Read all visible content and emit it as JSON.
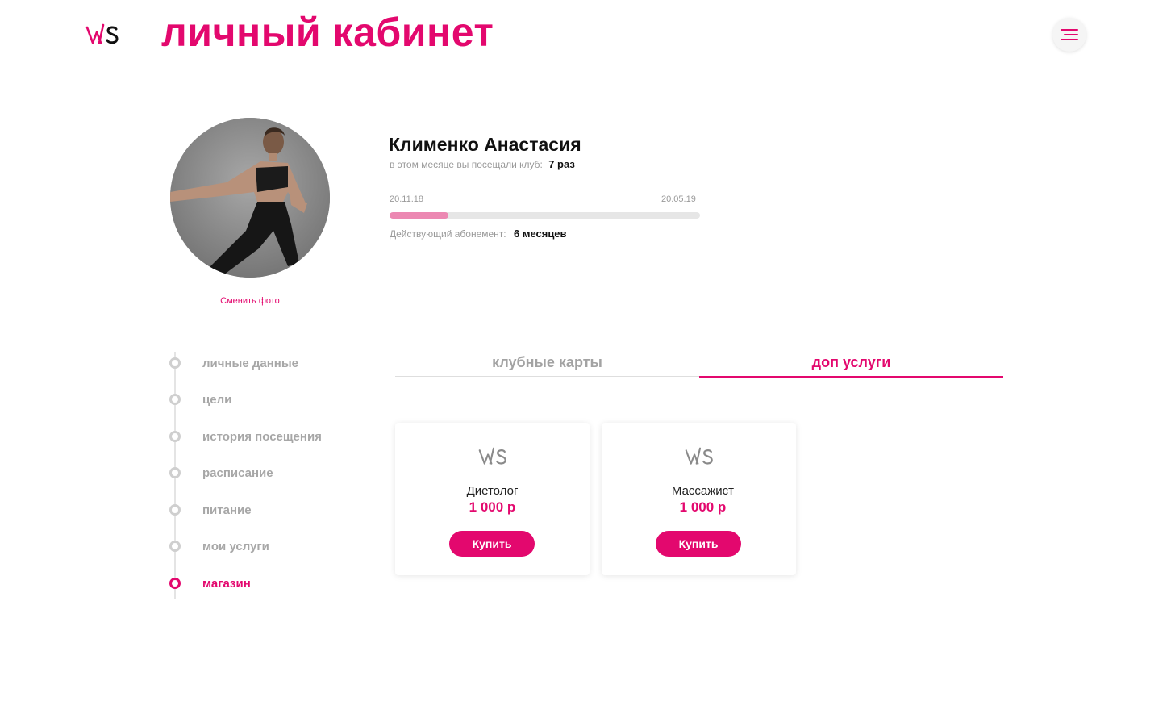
{
  "header": {
    "title": "личный кабинет",
    "logo_icon": "ws-logo-icon",
    "menu_icon": "hamburger-menu-icon"
  },
  "profile": {
    "name": "Клименко Анастасия",
    "visits_label": "в этом месяце вы посещали клуб:",
    "visits_value": "7 раз",
    "date_start": "20.11.18",
    "date_end": "20.05.19",
    "progress_fraction": 0.19,
    "subscription_label": "Действующий абонемент:",
    "subscription_value": "6 месяцев",
    "change_photo": "Сменить фото"
  },
  "sidebar": {
    "items": [
      {
        "label": "личные данные",
        "active": false
      },
      {
        "label": "цели",
        "active": false
      },
      {
        "label": "история посещения",
        "active": false
      },
      {
        "label": "расписание",
        "active": false
      },
      {
        "label": "питание",
        "active": false
      },
      {
        "label": "мои услуги",
        "active": false
      },
      {
        "label": "магазин",
        "active": true
      }
    ]
  },
  "tabs": [
    {
      "label": "клубные карты",
      "active": false
    },
    {
      "label": "доп услуги",
      "active": true
    }
  ],
  "cards": [
    {
      "title": "Диетолог",
      "price": "1 000 р",
      "button": "Купить"
    },
    {
      "title": "Массажист",
      "price": "1 000 р",
      "button": "Купить"
    }
  ],
  "colors": {
    "accent": "#e3086e",
    "progress_fill": "#ec88b2",
    "muted": "#a7a7a7"
  }
}
